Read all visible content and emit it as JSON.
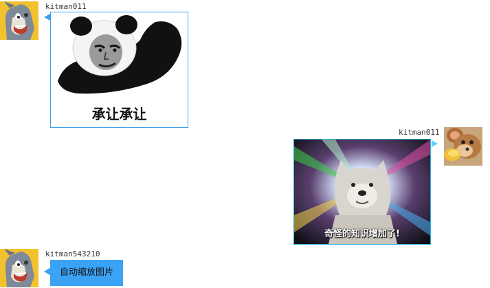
{
  "messages": [
    {
      "side": "left",
      "user": "kitman011",
      "avatar_icon": "tom-cat-avatar-icon",
      "type": "image",
      "caption": "承让承让"
    },
    {
      "side": "right",
      "user": "kitman011",
      "avatar_icon": "jerry-mouse-avatar-icon",
      "type": "image",
      "caption": "奇怪的知识增加了!"
    },
    {
      "side": "left",
      "user": "kitman543210",
      "avatar_icon": "tom-cat-avatar-icon",
      "type": "text",
      "text": "自动缩放图片"
    }
  ],
  "colors": {
    "bubble_blue": "#3aa3f5",
    "image_border": "#3aa0f0",
    "tail_right": "#5fd0f5"
  }
}
